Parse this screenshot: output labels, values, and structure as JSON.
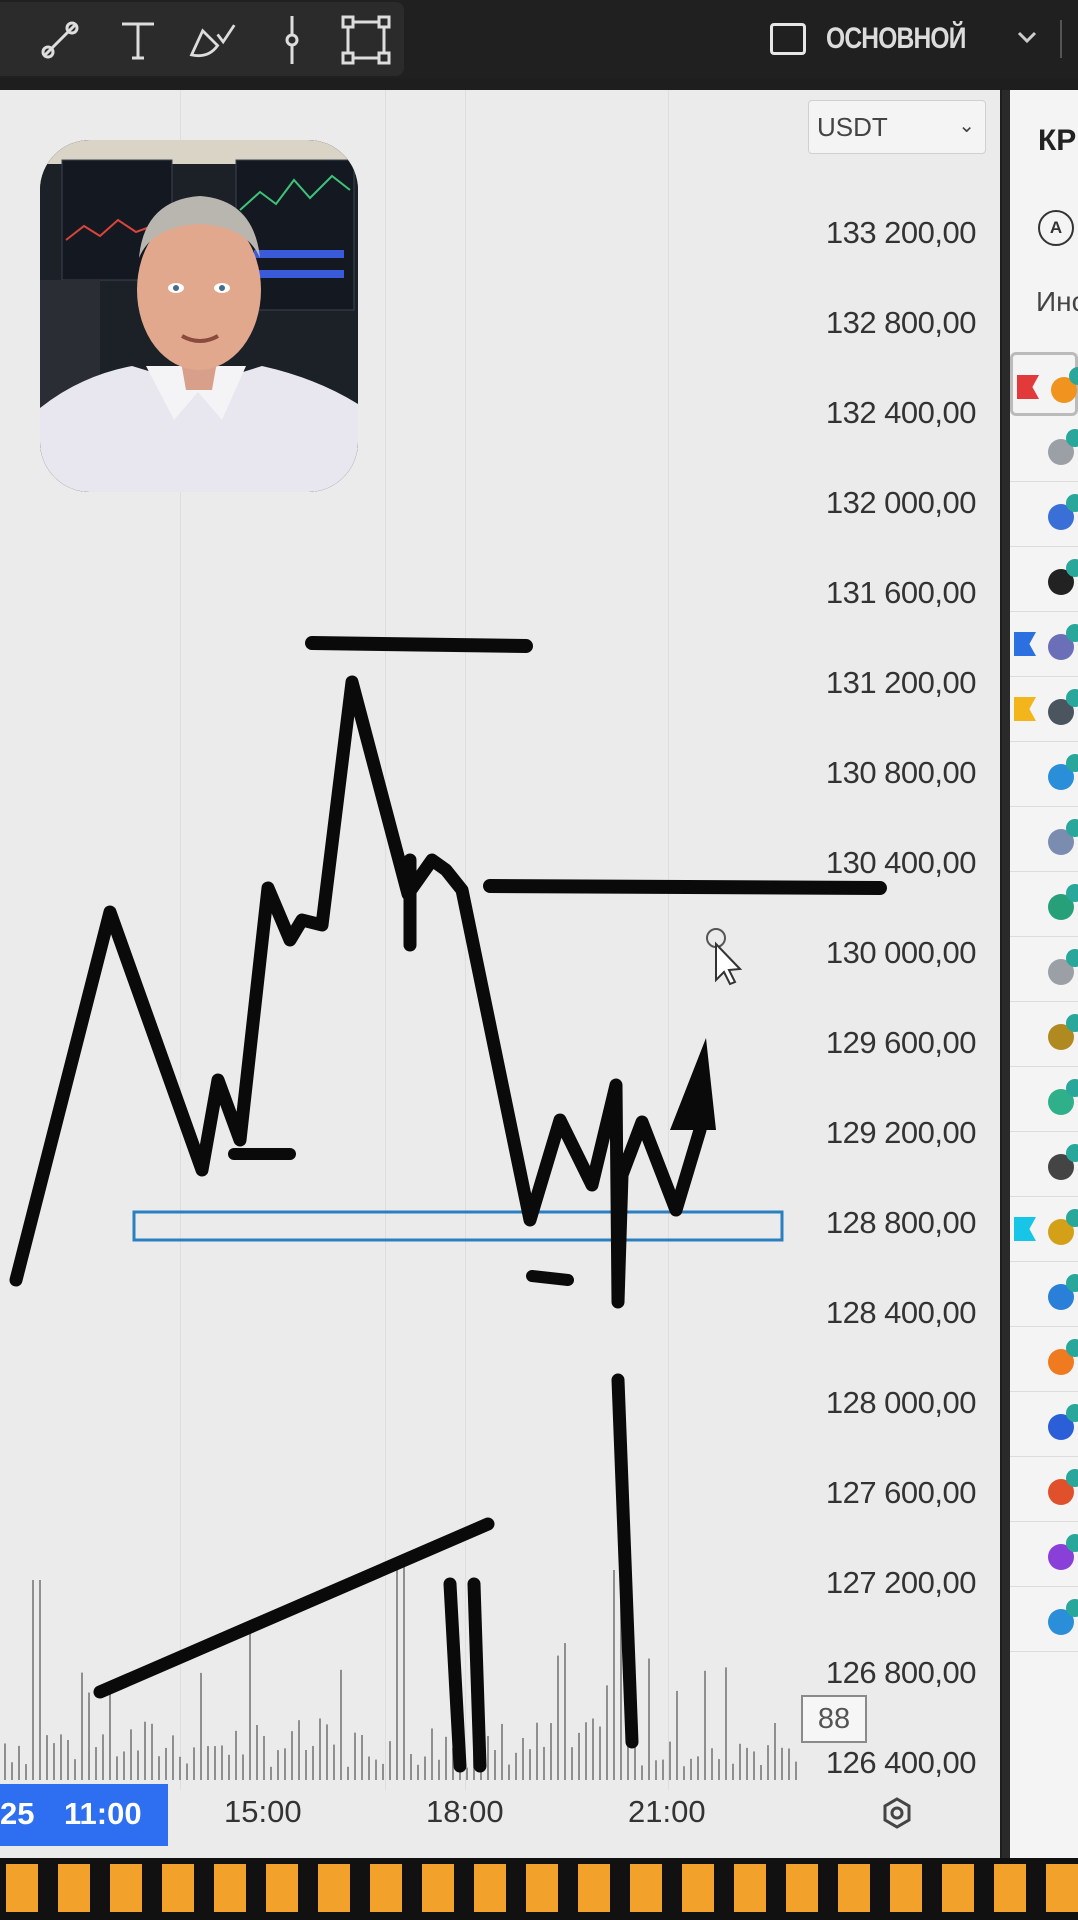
{
  "toolbar": {
    "tools": [
      "trend-line-tool",
      "text-tool",
      "brush-tool",
      "vertical-line-tool",
      "rectangle-tool"
    ],
    "layout_label": "ОСНОВНОЙ"
  },
  "chart": {
    "currency": "USDT",
    "price_labels": [
      "133 200,00",
      "132 800,00",
      "132 400,00",
      "132 000,00",
      "131 600,00",
      "131 200,00",
      "130 800,00",
      "130 400,00",
      "130 000,00",
      "129 600,00",
      "129 200,00",
      "128 800,00",
      "128 400,00",
      "128 000,00",
      "127 600,00",
      "127 200,00",
      "126 800,00",
      "126 400,00"
    ],
    "badge_value": "88",
    "date_chip_partial": "25",
    "date_chip_time": "11:00",
    "time_labels": [
      "15:00",
      "18:00",
      "21:00"
    ]
  },
  "right_panel": {
    "title_partial": "КРІ",
    "filter_letter": "A",
    "subheader_partial": "Инс",
    "rows": [
      {
        "flag": "#e23a3a",
        "coin": "#f0931f"
      },
      {
        "flag": null,
        "coin": "#9aa0a6"
      },
      {
        "flag": null,
        "coin": "#3b6fd8"
      },
      {
        "flag": null,
        "coin": "#222222"
      },
      {
        "flag": "#2c6fe0",
        "coin": "#6a6fb8"
      },
      {
        "flag": "#f2b51c",
        "coin": "#4a5560"
      },
      {
        "flag": null,
        "coin": "#2a8fd8"
      },
      {
        "flag": null,
        "coin": "#7a8db0"
      },
      {
        "flag": null,
        "coin": "#27a07a"
      },
      {
        "flag": null,
        "coin": "#9aa0a6"
      },
      {
        "flag": null,
        "coin": "#b08a20"
      },
      {
        "flag": null,
        "coin": "#2fb08a"
      },
      {
        "flag": null,
        "coin": "#444444"
      },
      {
        "flag": "#17c6e6",
        "coin": "#d4a017"
      },
      {
        "flag": null,
        "coin": "#2a7fd8"
      },
      {
        "flag": null,
        "coin": "#f07a1f"
      },
      {
        "flag": null,
        "coin": "#2a5fd8"
      },
      {
        "flag": null,
        "coin": "#e0502a"
      },
      {
        "flag": null,
        "coin": "#8a3fd8"
      },
      {
        "flag": null,
        "coin": "#2a8fd8"
      }
    ]
  },
  "colors": {
    "accent": "#2d6ff0",
    "tile": "#f2a12a",
    "zone_outline": "#2a7fc0"
  }
}
